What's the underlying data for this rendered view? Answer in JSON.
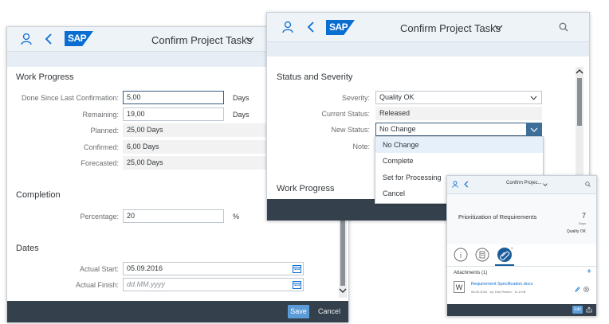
{
  "brand": "SAP",
  "win1": {
    "title": "Confirm Project Tasks",
    "sections": {
      "work_progress": "Work Progress",
      "completion": "Completion",
      "dates": "Dates"
    },
    "fields": {
      "done_since_label": "Done Since Last Confirmation:",
      "done_since_value": "5,00",
      "done_since_unit": "Days",
      "remaining_label": "Remaining:",
      "remaining_value": "19,00",
      "remaining_unit": "Days",
      "planned_label": "Planned:",
      "planned_value": "25,00 Days",
      "confirmed_label": "Confirmed:",
      "confirmed_value": "6,00 Days",
      "forecasted_label": "Forecasted:",
      "forecasted_value": "25,00 Days",
      "percentage_label": "Percentage:",
      "percentage_value": "20",
      "percentage_unit": "%",
      "actual_start_label": "Actual Start:",
      "actual_start_value": "05.09.2016",
      "actual_finish_label": "Actual Finish:",
      "actual_finish_placeholder": "dd.MM.yyyy"
    },
    "footer": {
      "save": "Save",
      "cancel": "Cancel"
    }
  },
  "win2": {
    "title": "Confirm Project Tasks",
    "section": "Status and Severity",
    "severity_label": "Severity:",
    "severity_value": "Quality OK",
    "current_status_label": "Current Status:",
    "current_status_value": "Released",
    "new_status_label": "New Status:",
    "new_status_value": "No Change",
    "note_label": "Note:",
    "work_progress": "Work Progress",
    "dropdown_options": [
      "No Change",
      "Complete",
      "Set for Processing",
      "Cancel"
    ]
  },
  "win3": {
    "title": "Confirm Projec...",
    "task_title": "Prioritization of Requirements",
    "days_value": "7",
    "days_unit": "Days",
    "status": "Quality OK",
    "attachments_header": "Attachments (1)",
    "add": "+",
    "file_name": "Requirement Specification.docx",
    "file_meta": "06.09.2016 · by: Dirk Richter · 11,5 KB",
    "edit": "Edit",
    "icon_tab_badge": "3"
  },
  "colors": {
    "shell": "#eef3f8",
    "footer": "#34404c",
    "accent": "#0a6ed1",
    "primary_button": "#5a9bd8"
  }
}
